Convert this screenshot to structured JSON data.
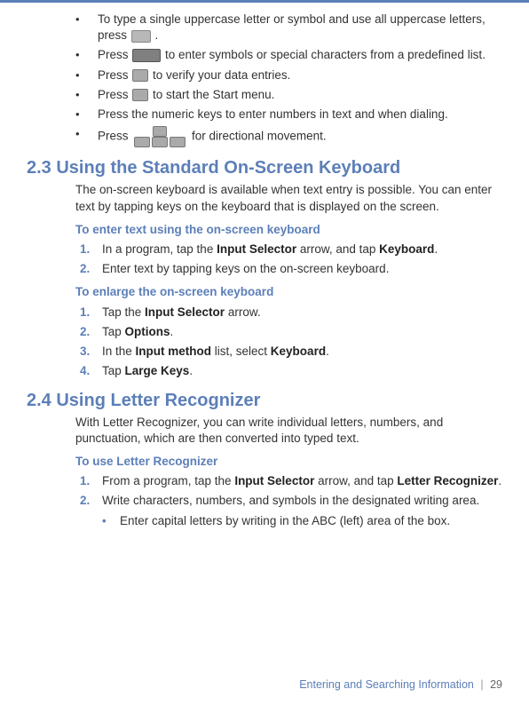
{
  "bullets": {
    "b1a": "To type a single uppercase letter or symbol and use all uppercase letters, press ",
    "b1b": " .",
    "b2a": "Press ",
    "b2b": " to enter symbols or special characters from a predefined list.",
    "b3a": "Press ",
    "b3b": " to verify your data entries.",
    "b4a": "Press ",
    "b4b": " to start the Start menu.",
    "b5": "Press the numeric keys to enter numbers in text and when dialing.",
    "b6a": "Press ",
    "b6b": " for directional movement."
  },
  "s23": {
    "title": "2.3 Using the Standard On-Screen Keyboard",
    "intro": "The on-screen keyboard is available when text entry is possible. You can enter text by tapping keys on the keyboard that is displayed on the screen.",
    "sub1": "To enter text using the on-screen keyboard",
    "steps1": {
      "s1a": "In a program, tap the ",
      "s1b": "Input Selector",
      "s1c": " arrow, and tap ",
      "s1d": "Keyboard",
      "s1e": ".",
      "s2": "Enter text by tapping keys on the on-screen keyboard."
    },
    "sub2": "To enlarge the on-screen keyboard",
    "steps2": {
      "s1a": "Tap the ",
      "s1b": "Input Selector",
      "s1c": " arrow.",
      "s2a": "Tap ",
      "s2b": "Options",
      "s2c": ".",
      "s3a": "In the ",
      "s3b": "Input method",
      "s3c": " list, select ",
      "s3d": "Keyboard",
      "s3e": ".",
      "s4a": "Tap ",
      "s4b": "Large Keys",
      "s4c": "."
    }
  },
  "s24": {
    "title": "2.4 Using Letter Recognizer",
    "intro": "With Letter Recognizer, you can write individual letters, numbers, and punctuation, which are then converted into typed text.",
    "sub1": "To use Letter Recognizer",
    "steps": {
      "s1a": "From a program, tap the ",
      "s1b": "Input Selector",
      "s1c": " arrow, and tap ",
      "s1d": "Letter Recognizer",
      "s1e": ".",
      "s2": "Write characters, numbers, and symbols in the designated writing area."
    },
    "sub_bullet": "Enter capital letters by writing in the ABC (left) area of the box."
  },
  "footer": {
    "chapter": "Entering and Searching Information",
    "page": "29"
  }
}
